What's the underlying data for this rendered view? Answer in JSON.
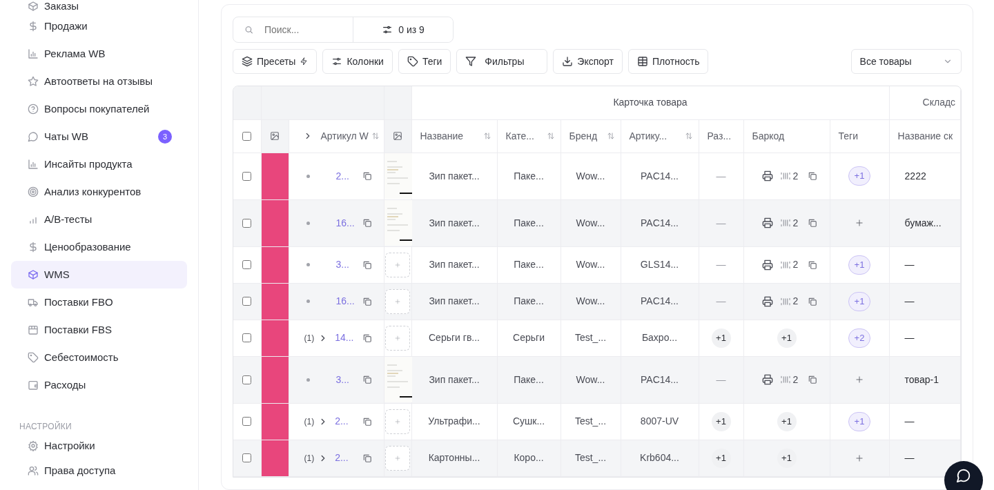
{
  "sidebar": {
    "items": [
      {
        "label": "Заказы",
        "selected": false
      },
      {
        "label": "Продажи",
        "selected": false
      },
      {
        "label": "Реклама WB",
        "selected": false
      },
      {
        "label": "Автоответы на отзывы",
        "selected": false
      },
      {
        "label": "Вопросы покупателей",
        "selected": false
      },
      {
        "label": "Чаты WB",
        "selected": false,
        "badge": "3"
      },
      {
        "label": "Инсайты продукта",
        "selected": false
      },
      {
        "label": "Анализ конкурентов",
        "selected": false
      },
      {
        "label": "A/B-тесты",
        "selected": false
      },
      {
        "label": "Ценообразование",
        "selected": false
      },
      {
        "label": "WMS",
        "selected": true
      },
      {
        "label": "Поставки FBO",
        "selected": false
      },
      {
        "label": "Поставки FBS",
        "selected": false
      },
      {
        "label": "Себестоимость",
        "selected": false
      },
      {
        "label": "Расходы",
        "selected": false
      }
    ],
    "section_title": "НАСТРОЙКИ",
    "settings_items": [
      {
        "label": "Настройки",
        "selected": false
      },
      {
        "label": "Права доступа",
        "selected": false
      }
    ]
  },
  "search": {
    "placeholder": "Поиск...",
    "filter_count": "0 из 9"
  },
  "toolbar": [
    {
      "label": "Пресеты"
    },
    {
      "label": "Колонки"
    },
    {
      "label": "Теги"
    },
    {
      "label": "Фильтры"
    },
    {
      "label": "Экспорт"
    },
    {
      "label": "Плотность"
    }
  ],
  "product_filter": {
    "value": "Все товары"
  },
  "table": {
    "header_checkbox": {
      "checked": false
    },
    "groups": [
      "Карточка товара",
      "Складс"
    ],
    "columns": [
      {
        "label": "Артикул W",
        "sortable": true
      },
      {
        "label": "Название",
        "sortable": true
      },
      {
        "label": "Кате...",
        "sortable": true
      },
      {
        "label": "Бренд",
        "sortable": true
      },
      {
        "label": "Артику...",
        "sortable": true
      },
      {
        "label": "Раз...",
        "sortable": false
      },
      {
        "label": "Баркод",
        "sortable": false
      },
      {
        "label": "Теги",
        "sortable": false
      },
      {
        "label": "Название ск",
        "sortable": false
      }
    ],
    "rows": [
      {
        "checked": false,
        "article": {
          "kind": "single",
          "text": "2..."
        },
        "media": {
          "kind": "image"
        },
        "name": "Зип пакет...",
        "category": "Паке...",
        "brand": "Wow...",
        "sku": "PAC14...",
        "size": {
          "kind": "dash",
          "text": "—"
        },
        "barcode": {
          "kind": "code",
          "text": "2"
        },
        "tags": {
          "kind": "count",
          "text": "+1"
        },
        "warehouse": "2222"
      },
      {
        "checked": false,
        "article": {
          "kind": "single",
          "text": "16..."
        },
        "media": {
          "kind": "image"
        },
        "name": "Зип пакет...",
        "category": "Паке...",
        "brand": "Wow...",
        "sku": "PAC14...",
        "size": {
          "kind": "dash",
          "text": "—"
        },
        "barcode": {
          "kind": "code",
          "text": "2"
        },
        "tags": {
          "kind": "add"
        },
        "warehouse": "бумаж..."
      },
      {
        "checked": false,
        "article": {
          "kind": "single",
          "text": "3..."
        },
        "media": {
          "kind": "add"
        },
        "name": "Зип пакет...",
        "category": "Паке...",
        "brand": "Wow...",
        "sku": "GLS14...",
        "size": {
          "kind": "dash",
          "text": "—"
        },
        "barcode": {
          "kind": "code",
          "text": "2"
        },
        "tags": {
          "kind": "count",
          "text": "+1"
        },
        "warehouse": "—"
      },
      {
        "checked": false,
        "article": {
          "kind": "single",
          "text": "16..."
        },
        "media": {
          "kind": "add"
        },
        "name": "Зип пакет...",
        "category": "Паке...",
        "brand": "Wow...",
        "sku": "PAC14...",
        "size": {
          "kind": "dash",
          "text": "—"
        },
        "barcode": {
          "kind": "code",
          "text": "2"
        },
        "tags": {
          "kind": "count",
          "text": "+1"
        },
        "warehouse": "—"
      },
      {
        "checked": false,
        "article": {
          "kind": "group",
          "count": "(1)",
          "text": "14..."
        },
        "media": {
          "kind": "add"
        },
        "name": "Серьги гв...",
        "category": "Серьги",
        "brand": "Test_...",
        "sku": "Бахро...",
        "size": {
          "kind": "count",
          "text": "+1"
        },
        "barcode": {
          "kind": "count",
          "text": "+1"
        },
        "tags": {
          "kind": "count",
          "text": "+2"
        },
        "warehouse": "—"
      },
      {
        "checked": false,
        "article": {
          "kind": "single",
          "text": "3..."
        },
        "media": {
          "kind": "image"
        },
        "name": "Зип пакет...",
        "category": "Паке...",
        "brand": "Wow...",
        "sku": "PAC14...",
        "size": {
          "kind": "dash",
          "text": "—"
        },
        "barcode": {
          "kind": "code",
          "text": "2"
        },
        "tags": {
          "kind": "add"
        },
        "warehouse": "товар-1"
      },
      {
        "checked": false,
        "article": {
          "kind": "group",
          "count": "(1)",
          "text": "2..."
        },
        "media": {
          "kind": "add"
        },
        "name": "Ультрафи...",
        "category": "Сушк...",
        "brand": "Test_...",
        "sku": "8007-UV",
        "size": {
          "kind": "count",
          "text": "+1"
        },
        "barcode": {
          "kind": "count",
          "text": "+1"
        },
        "tags": {
          "kind": "count",
          "text": "+1"
        },
        "warehouse": "—"
      },
      {
        "checked": false,
        "article": {
          "kind": "group",
          "count": "(1)",
          "text": "2..."
        },
        "media": {
          "kind": "add"
        },
        "name": "Картонны...",
        "category": "Коро...",
        "brand": "Test_...",
        "sku": "Krb604...",
        "size": {
          "kind": "count",
          "text": "+1"
        },
        "barcode": {
          "kind": "count",
          "text": "+1"
        },
        "tags": {
          "kind": "add"
        },
        "warehouse": "—"
      }
    ]
  }
}
